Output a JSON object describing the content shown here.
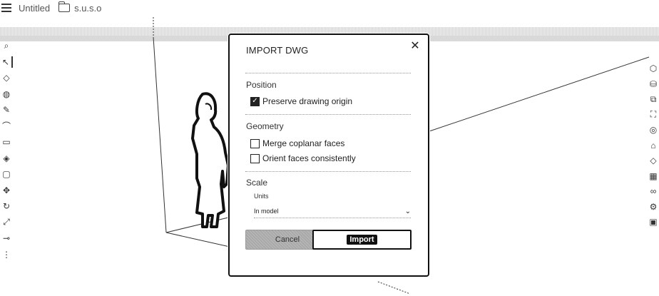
{
  "topbar": {
    "doc_title": "Untitled",
    "filename": "s.u.s.o",
    "icons": [
      "menu-icon",
      "folder-icon"
    ]
  },
  "left_toolbar": {
    "tools": [
      {
        "name": "search-icon",
        "glyph": "⌕"
      },
      {
        "name": "select-icon",
        "glyph": "↖"
      },
      {
        "name": "eraser-icon",
        "glyph": "◇"
      },
      {
        "name": "paint-bucket-icon",
        "glyph": "◍"
      },
      {
        "name": "pencil-icon",
        "glyph": "✎"
      },
      {
        "name": "arc-icon",
        "glyph": "⌒"
      },
      {
        "name": "rectangle-icon",
        "glyph": "▭"
      },
      {
        "name": "push-pull-icon",
        "glyph": "◈"
      },
      {
        "name": "offset-icon",
        "glyph": "▢"
      },
      {
        "name": "move-icon",
        "glyph": "✥"
      },
      {
        "name": "rotate-icon",
        "glyph": "↻"
      },
      {
        "name": "scale-icon",
        "glyph": "⤢"
      },
      {
        "name": "tape-measure-icon",
        "glyph": "⊸"
      },
      {
        "name": "more-tools-icon",
        "glyph": "⋮"
      }
    ]
  },
  "right_toolbar": {
    "tools": [
      {
        "name": "entity-info-icon",
        "glyph": "⬡"
      },
      {
        "name": "components-icon",
        "glyph": "⛁"
      },
      {
        "name": "layers-icon",
        "glyph": "⧉"
      },
      {
        "name": "materials-icon",
        "glyph": "⛶"
      },
      {
        "name": "styles-icon",
        "glyph": "◎"
      },
      {
        "name": "outliner-icon",
        "glyph": "⌂"
      },
      {
        "name": "tags-icon",
        "glyph": "◇"
      },
      {
        "name": "scenes-icon",
        "glyph": "▦"
      },
      {
        "name": "display-icon",
        "glyph": "∞"
      },
      {
        "name": "extensions-icon",
        "glyph": "⚙"
      },
      {
        "name": "instructor-icon",
        "glyph": "▣"
      }
    ]
  },
  "dialog": {
    "title": "IMPORT DWG",
    "close_icon": "close-icon",
    "sections": {
      "position": {
        "label": "Position",
        "preserve_origin": {
          "label": "Preserve drawing origin",
          "checked": true
        }
      },
      "geometry": {
        "label": "Geometry",
        "merge_faces": {
          "label": "Merge coplanar faces",
          "checked": false
        },
        "orient_faces": {
          "label": "Orient faces consistently",
          "checked": false
        }
      },
      "scale": {
        "label": "Scale",
        "units_label": "Units",
        "units_value": "In model"
      }
    },
    "buttons": {
      "cancel": "Cancel",
      "import": "Import"
    }
  },
  "colors": {
    "dialog_border": "#111111",
    "cancel_bg": "#b0b0b0",
    "axis_line": "#333333"
  }
}
